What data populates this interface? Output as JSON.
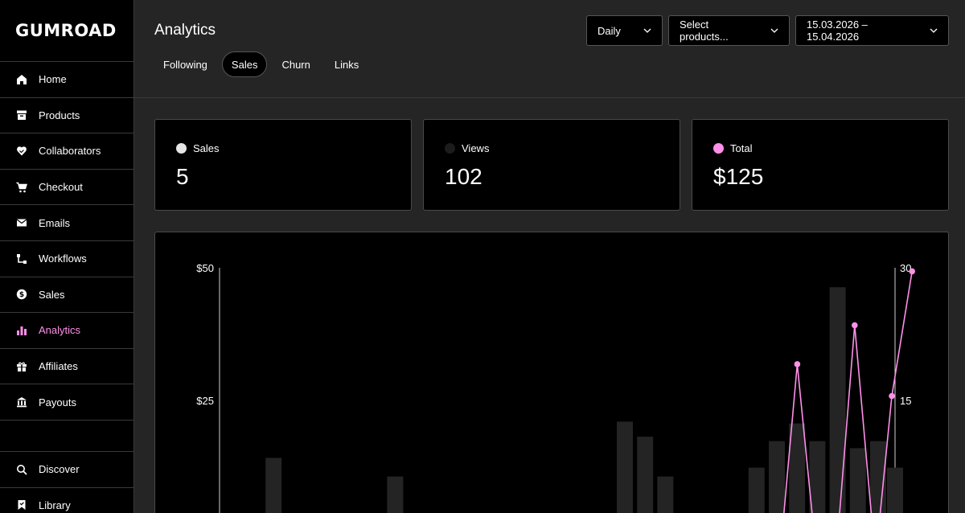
{
  "brand": {
    "name": "GUMROAD"
  },
  "sidebar": {
    "items": [
      {
        "label": "Home",
        "icon": "home-icon"
      },
      {
        "label": "Products",
        "icon": "archive-icon"
      },
      {
        "label": "Collaborators",
        "icon": "handshake-icon"
      },
      {
        "label": "Checkout",
        "icon": "cart-icon"
      },
      {
        "label": "Emails",
        "icon": "envelope-icon"
      },
      {
        "label": "Workflows",
        "icon": "workflow-icon"
      },
      {
        "label": "Sales",
        "icon": "dollar-circle-icon"
      },
      {
        "label": "Analytics",
        "icon": "bar-chart-icon",
        "active": true
      },
      {
        "label": "Affiliates",
        "icon": "gift-icon"
      },
      {
        "label": "Payouts",
        "icon": "bank-icon"
      }
    ],
    "bottom_items": [
      {
        "label": "Discover",
        "icon": "search-icon"
      },
      {
        "label": "Library",
        "icon": "bookmark-icon"
      }
    ]
  },
  "header": {
    "title": "Analytics",
    "tabs": [
      {
        "label": "Following"
      },
      {
        "label": "Sales",
        "active": true
      },
      {
        "label": "Churn"
      },
      {
        "label": "Links"
      }
    ],
    "period_select": "Daily",
    "product_select": "Select products...",
    "date_range": "15.03.2026 – 15.04.2026"
  },
  "stats": {
    "sales": {
      "label": "Sales",
      "value": "5",
      "color": "#e6e6e6"
    },
    "views": {
      "label": "Views",
      "value": "102",
      "color": "#1c1c1c"
    },
    "total": {
      "label": "Total",
      "value": "$125",
      "color": "#ff90e8"
    }
  },
  "colors": {
    "accent": "#ff90e8",
    "bar": "#242424",
    "axis": "#cfcfcf"
  },
  "chart_data": {
    "type": "bar",
    "left_axis": {
      "ticks": [
        "$50",
        "$25"
      ],
      "ylim": [
        0,
        50
      ]
    },
    "right_axis": {
      "ticks": [
        "30",
        "15"
      ],
      "ylim": [
        0,
        30
      ]
    },
    "visible_y_floor": {
      "left": 10,
      "right": 6
    },
    "bars_views": [
      0,
      0,
      0,
      0,
      0,
      0,
      0,
      3,
      0,
      0,
      0,
      0,
      0,
      0,
      0,
      0,
      0,
      0,
      0,
      0,
      0,
      0,
      0,
      0,
      0,
      0,
      0,
      0,
      0,
      0,
      0,
      0,
      0,
      0,
      0,
      0,
      0,
      0,
      0,
      0,
      0,
      0,
      0,
      0,
      0,
      0,
      0,
      0,
      0,
      0,
      0,
      0,
      0,
      0,
      0,
      0,
      0,
      0,
      0,
      0,
      0,
      0,
      0,
      0,
      0,
      0,
      0,
      0,
      0,
      0,
      0,
      0,
      0,
      0,
      0,
      0,
      0,
      0,
      0,
      0,
      0,
      0,
      0,
      0,
      0,
      0,
      0,
      0,
      0,
      0,
      0,
      0,
      0,
      0,
      0,
      0,
      0,
      0,
      0,
      0,
      0,
      0,
      0,
      0,
      0,
      0,
      0,
      0,
      0,
      0,
      0,
      0,
      0,
      0,
      0,
      0,
      0,
      0,
      0,
      0,
      0,
      0
    ],
    "views": [
      {
        "x": 0.08,
        "y": 8.5
      },
      {
        "x": 0.26,
        "y": 6.4
      },
      {
        "x": 0.6,
        "y": 12.6
      },
      {
        "x": 0.63,
        "y": 10.9
      },
      {
        "x": 0.66,
        "y": 6.4
      },
      {
        "x": 0.795,
        "y": 7.4
      },
      {
        "x": 0.825,
        "y": 10.4
      },
      {
        "x": 0.855,
        "y": 12.4
      },
      {
        "x": 0.885,
        "y": 10.4
      },
      {
        "x": 0.915,
        "y": 27.8
      },
      {
        "x": 0.945,
        "y": 9.6
      },
      {
        "x": 0.975,
        "y": 10.4
      },
      {
        "x": 1.0,
        "y": 7.4
      }
    ],
    "total_line": [
      {
        "x": 0.86,
        "y": 19.1
      },
      {
        "x": 0.945,
        "y": 23.5
      },
      {
        "x": 1.0,
        "y": 15.5
      },
      {
        "x": 1.03,
        "y": 29.6
      }
    ]
  }
}
